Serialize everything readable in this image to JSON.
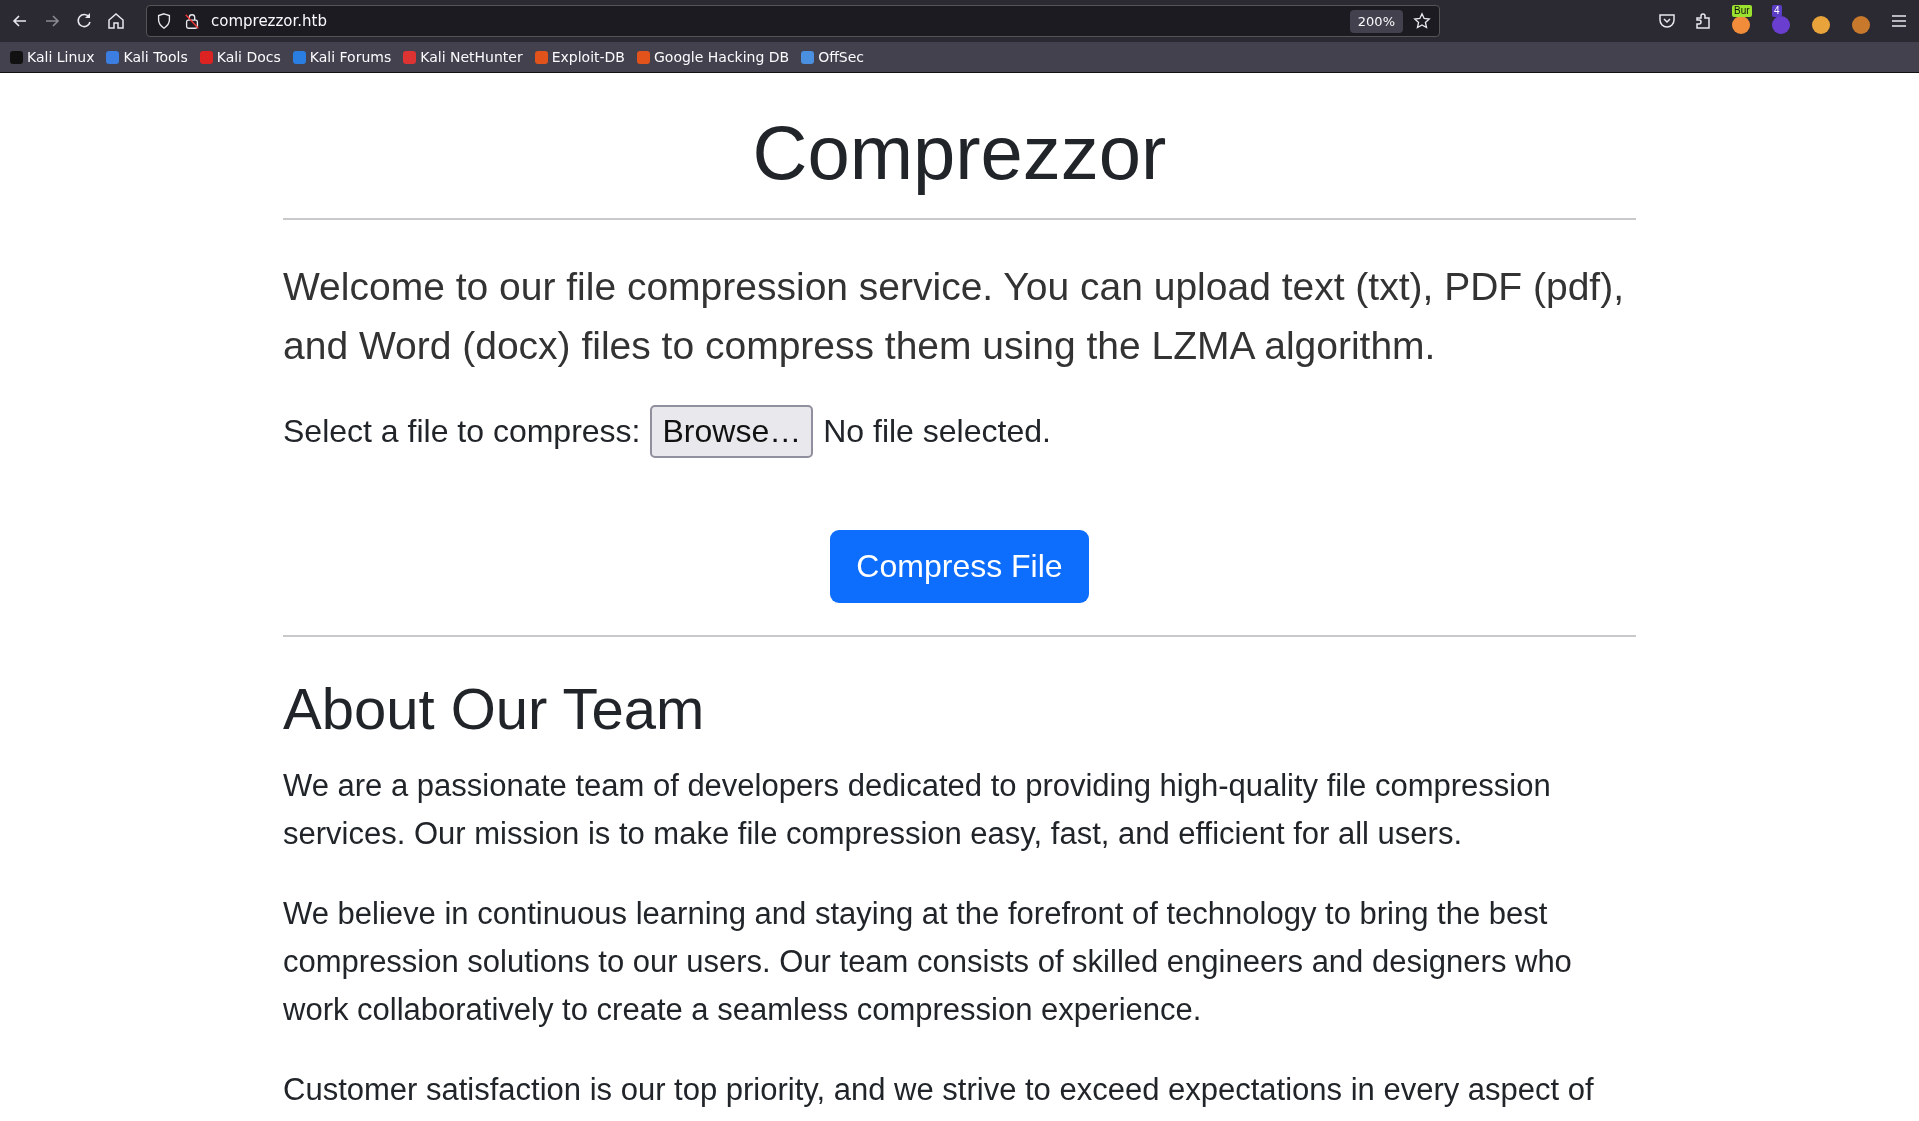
{
  "browser": {
    "url": "comprezzor.htb",
    "zoom": "200%",
    "extensions": [
      {
        "kind": "pocket"
      },
      {
        "kind": "puzzle"
      },
      {
        "kind": "burp",
        "badge": "Bur"
      },
      {
        "kind": "stack",
        "badge": "4"
      },
      {
        "kind": "pizza"
      },
      {
        "kind": "cookie"
      }
    ],
    "bookmarks": [
      {
        "label": "Kali Linux",
        "kind": "dragon"
      },
      {
        "label": "Kali Tools",
        "kind": "tools"
      },
      {
        "label": "Kali Docs",
        "kind": "docs"
      },
      {
        "label": "Kali Forums",
        "kind": "forums"
      },
      {
        "label": "Kali NetHunter",
        "kind": "nethunter"
      },
      {
        "label": "Exploit-DB",
        "kind": "bug"
      },
      {
        "label": "Google Hacking DB",
        "kind": "bug"
      },
      {
        "label": "OffSec",
        "kind": "offsec"
      }
    ]
  },
  "page": {
    "title": "Comprezzor",
    "lead": "Welcome to our file compression service. You can upload text (txt), PDF (pdf), and Word (docx) files to compress them using the LZMA algorithm.",
    "file_label": "Select a file to compress:",
    "browse_button": "Browse…",
    "file_status": "No file selected.",
    "submit_button": "Compress File",
    "about_heading": "About Our Team",
    "paragraphs": [
      "We are a passionate team of developers dedicated to providing high-quality file compression services. Our mission is to make file compression easy, fast, and efficient for all users.",
      "We believe in continuous learning and staying at the forefront of technology to bring the best compression solutions to our users. Our team consists of skilled engineers and designers who work collaboratively to create a seamless compression experience.",
      "Customer satisfaction is our top priority, and we strive to exceed expectations in every aspect of"
    ]
  }
}
